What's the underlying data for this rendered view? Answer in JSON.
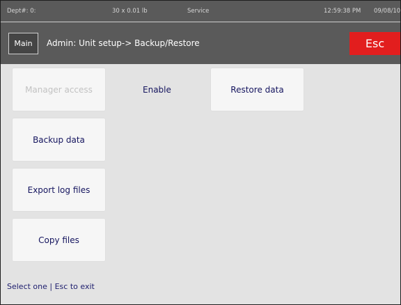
{
  "status_bar": {
    "dept": "Dept#: 0:",
    "unit": "30 x 0.01 lb",
    "mode": "Service",
    "time": "12:59:38 PM",
    "date": "09/08/10"
  },
  "header": {
    "main_label": "Main",
    "breadcrumb": "Admin: Unit setup-> Backup/Restore",
    "esc_label": "Esc"
  },
  "options": {
    "manager_access": "Manager access",
    "enable": "Enable",
    "restore_data": "Restore data",
    "backup_data": "Backup data",
    "export_log_files": "Export log files",
    "copy_files": "Copy files"
  },
  "footer": {
    "message": "Select one | Esc to exit"
  },
  "colors": {
    "esc_red": "#e21e1e",
    "header_gray": "#5a5a5a",
    "text_navy": "#14145e"
  }
}
